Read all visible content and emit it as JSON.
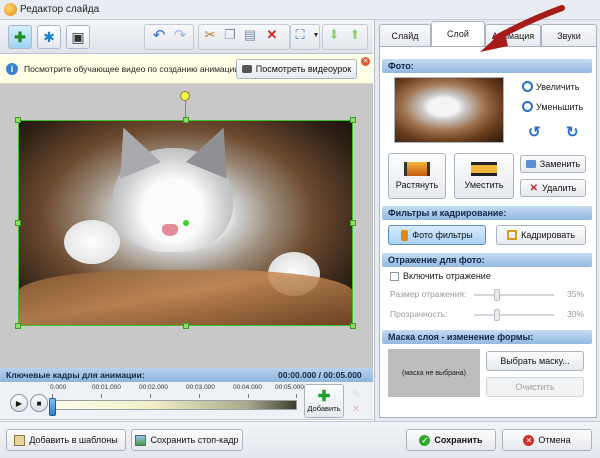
{
  "window": {
    "title": "Редактор слайда"
  },
  "hint": {
    "text": "Посмотрите обучающее видео по созданию анимации для своих фото...",
    "video_button": "Посмотреть видеоурок"
  },
  "tabs": [
    {
      "label": "Слайд"
    },
    {
      "label": "Слой",
      "active": true
    },
    {
      "label": "Анимация"
    },
    {
      "label": "Звуки"
    }
  ],
  "photo": {
    "header": "Фото:",
    "zoom_in": "Увеличить",
    "zoom_out": "Уменьшить",
    "stretch": "Растянуть",
    "fit": "Уместить",
    "replace": "Заменить",
    "delete": "Удалить"
  },
  "filters": {
    "header": "Фильтры и кадрирование:",
    "photo_filters": "Фото фильтры",
    "crop": "Кадрировать"
  },
  "reflection": {
    "header": "Отражение для фото:",
    "enable_label": "Включить отражение",
    "enabled": false,
    "size_label": "Размер отражения:",
    "size_value": "35%",
    "transparency_label": "Прозрачность:",
    "transparency_value": "30%"
  },
  "mask": {
    "header": "Маска слоя - изменение формы:",
    "placeholder": "(маска не выбрана)",
    "choose": "Выбрать маску...",
    "clear": "Очистить"
  },
  "timeline": {
    "header": "Ключевые кадры для анимации:",
    "time": "00:00.000 / 00:05.000",
    "ticks": [
      "0.000",
      "00:01.000",
      "00:02.000",
      "00:03.000",
      "00:04.000",
      "00:05.000"
    ],
    "add_label": "Добавить"
  },
  "bottom": {
    "add_template": "Добавить в шаблоны",
    "save_frame": "Сохранить стоп-кадр",
    "save": "Сохранить",
    "cancel": "Отмена"
  },
  "colors": {
    "accent_red": "#a61b1b",
    "header_blue": "#93b8e0",
    "handle_green": "#3fbf2a"
  }
}
